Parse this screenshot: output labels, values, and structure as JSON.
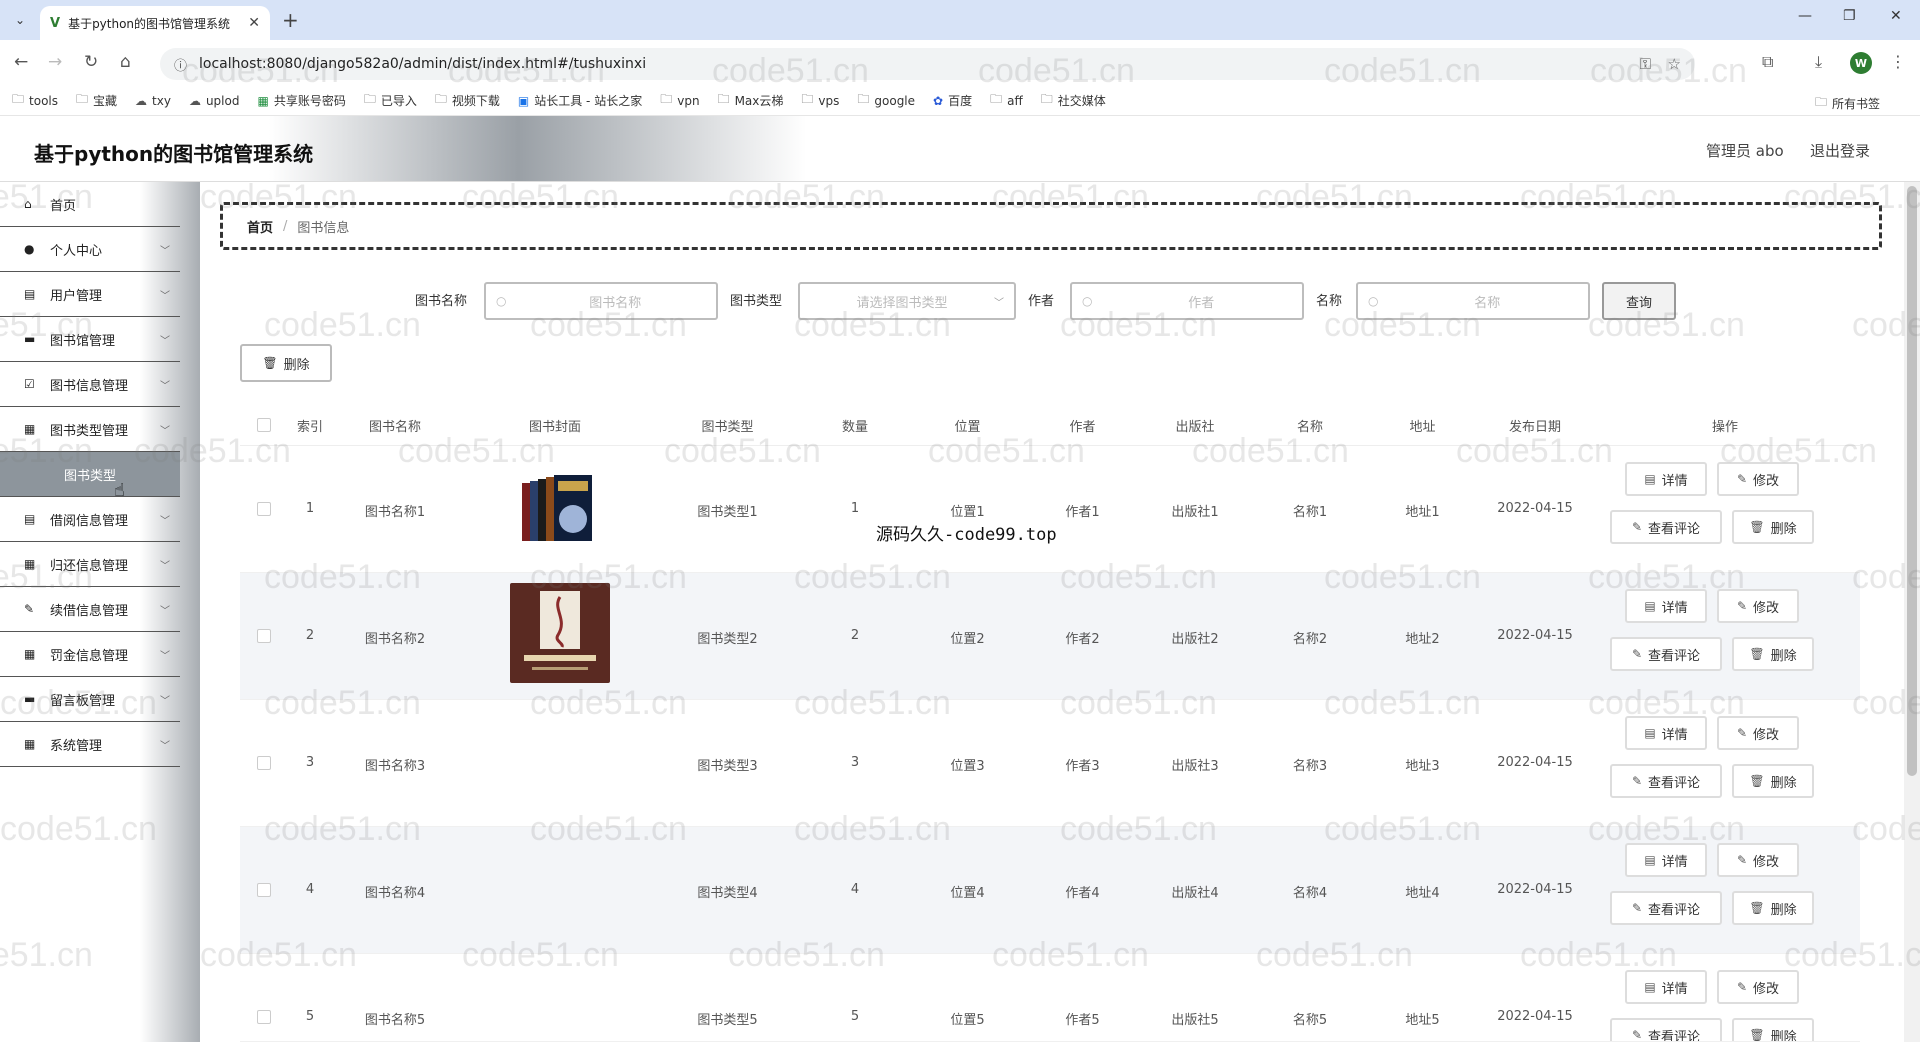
{
  "browser": {
    "tab_title": "基于python的图书馆管理系统",
    "url": "localhost:8080/django582a0/admin/dist/index.html#/tushuxinxi",
    "profile_initial": "W",
    "bookmarks": [
      {
        "label": "tools",
        "icon": "folder-icon"
      },
      {
        "label": "宝藏",
        "icon": "folder-icon"
      },
      {
        "label": "txy",
        "icon": "cloud-icon"
      },
      {
        "label": "uplod",
        "icon": "cloud-icon"
      },
      {
        "label": "共享账号密码",
        "icon": "sheet-icon"
      },
      {
        "label": "已导入",
        "icon": "folder-icon"
      },
      {
        "label": "视频下载",
        "icon": "folder-icon"
      },
      {
        "label": "站长工具 - 站长之家",
        "icon": "site-icon"
      },
      {
        "label": "vpn",
        "icon": "folder-icon"
      },
      {
        "label": "Max云梯",
        "icon": "folder-icon"
      },
      {
        "label": "vps",
        "icon": "folder-icon"
      },
      {
        "label": "google",
        "icon": "folder-icon"
      },
      {
        "label": "百度",
        "icon": "baidu-icon"
      },
      {
        "label": "aff",
        "icon": "folder-icon"
      },
      {
        "label": "社交媒体",
        "icon": "folder-icon"
      }
    ],
    "all_bookmarks": "所有书签"
  },
  "header": {
    "title": "基于python的图书馆管理系统",
    "admin": "管理员 abo",
    "logout": "退出登录"
  },
  "sidebar": {
    "items": [
      {
        "label": "首页",
        "icon": "home-icon",
        "has_children": false
      },
      {
        "label": "个人中心",
        "icon": "user-icon",
        "has_children": true
      },
      {
        "label": "用户管理",
        "icon": "clipboard-icon",
        "has_children": true
      },
      {
        "label": "图书馆管理",
        "icon": "building-icon",
        "has_children": true
      },
      {
        "label": "图书信息管理",
        "icon": "checklist-icon",
        "has_children": true
      },
      {
        "label": "图书类型管理",
        "icon": "grid-icon",
        "has_children": true
      },
      {
        "label": "借阅信息管理",
        "icon": "clipboard-icon",
        "has_children": true
      },
      {
        "label": "归还信息管理",
        "icon": "grid-icon",
        "has_children": true
      },
      {
        "label": "续借信息管理",
        "icon": "edit-icon",
        "has_children": true
      },
      {
        "label": "罚金信息管理",
        "icon": "grid-icon",
        "has_children": true
      },
      {
        "label": "留言板管理",
        "icon": "message-icon",
        "has_children": true
      },
      {
        "label": "系统管理",
        "icon": "grid-icon",
        "has_children": true
      }
    ],
    "submenu_label": "图书类型"
  },
  "breadcrumb": {
    "home": "首页",
    "current": "图书信息"
  },
  "filters": {
    "book_name_label": "图书名称",
    "book_name_placeholder": "图书名称",
    "book_type_label": "图书类型",
    "book_type_placeholder": "请选择图书类型",
    "author_label": "作者",
    "author_placeholder": "作者",
    "name_label": "名称",
    "name_placeholder": "名称",
    "query_button": "查询",
    "delete_button": "删除"
  },
  "table": {
    "columns": [
      "索引",
      "图书名称",
      "图书封面",
      "图书类型",
      "数量",
      "位置",
      "作者",
      "出版社",
      "名称",
      "地址",
      "发布日期",
      "操作"
    ],
    "rows": [
      {
        "index": "1",
        "name": "图书名称1",
        "type": "图书类型1",
        "qty": "1",
        "location": "位置1",
        "author": "作者1",
        "publisher": "出版社1",
        "title": "名称1",
        "address": "地址1",
        "date": "2022-04-15"
      },
      {
        "index": "2",
        "name": "图书名称2",
        "type": "图书类型2",
        "qty": "2",
        "location": "位置2",
        "author": "作者2",
        "publisher": "出版社2",
        "title": "名称2",
        "address": "地址2",
        "date": "2022-04-15"
      },
      {
        "index": "3",
        "name": "图书名称3",
        "type": "图书类型3",
        "qty": "3",
        "location": "位置3",
        "author": "作者3",
        "publisher": "出版社3",
        "title": "名称3",
        "address": "地址3",
        "date": "2022-04-15"
      },
      {
        "index": "4",
        "name": "图书名称4",
        "type": "图书类型4",
        "qty": "4",
        "location": "位置4",
        "author": "作者4",
        "publisher": "出版社4",
        "title": "名称4",
        "address": "地址4",
        "date": "2022-04-15"
      },
      {
        "index": "5",
        "name": "图书名称5",
        "type": "图书类型5",
        "qty": "5",
        "location": "位置5",
        "author": "作者5",
        "publisher": "出版社5",
        "title": "名称5",
        "address": "地址5",
        "date": "2022-04-15"
      }
    ],
    "actions": {
      "detail": "详情",
      "edit": "修改",
      "comments": "查看评论",
      "delete": "删除"
    }
  },
  "overlay_text": "源码久久-code99.top",
  "watermark": "code51.cn"
}
